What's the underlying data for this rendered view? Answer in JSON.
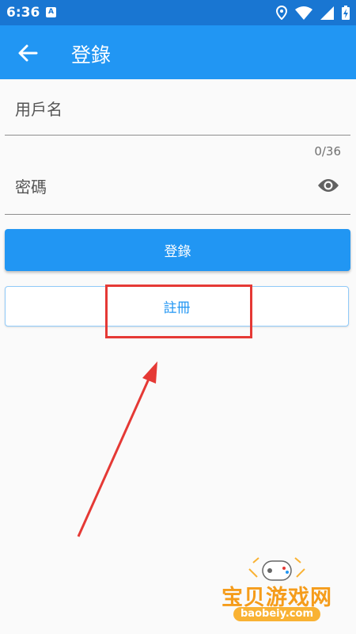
{
  "status_bar": {
    "time": "6:36",
    "notification_glyph": "A",
    "icons": [
      "location-icon",
      "wifi-icon",
      "signal-icon",
      "battery-icon"
    ]
  },
  "app_bar": {
    "title": "登錄",
    "back_icon": "arrow-left-icon"
  },
  "form": {
    "username_label": "用戶名",
    "password_label": "密碼",
    "password_counter": "0/36",
    "eye_icon": "eye-icon"
  },
  "buttons": {
    "login_label": "登錄",
    "register_label": "註冊"
  },
  "watermark": {
    "title": "宝贝游戏网",
    "url": "baobeiy.com"
  },
  "colors": {
    "status_bar": "#1976d2",
    "app_bar": "#2196f3",
    "primary": "#2196f3",
    "annotation": "#e53935"
  }
}
